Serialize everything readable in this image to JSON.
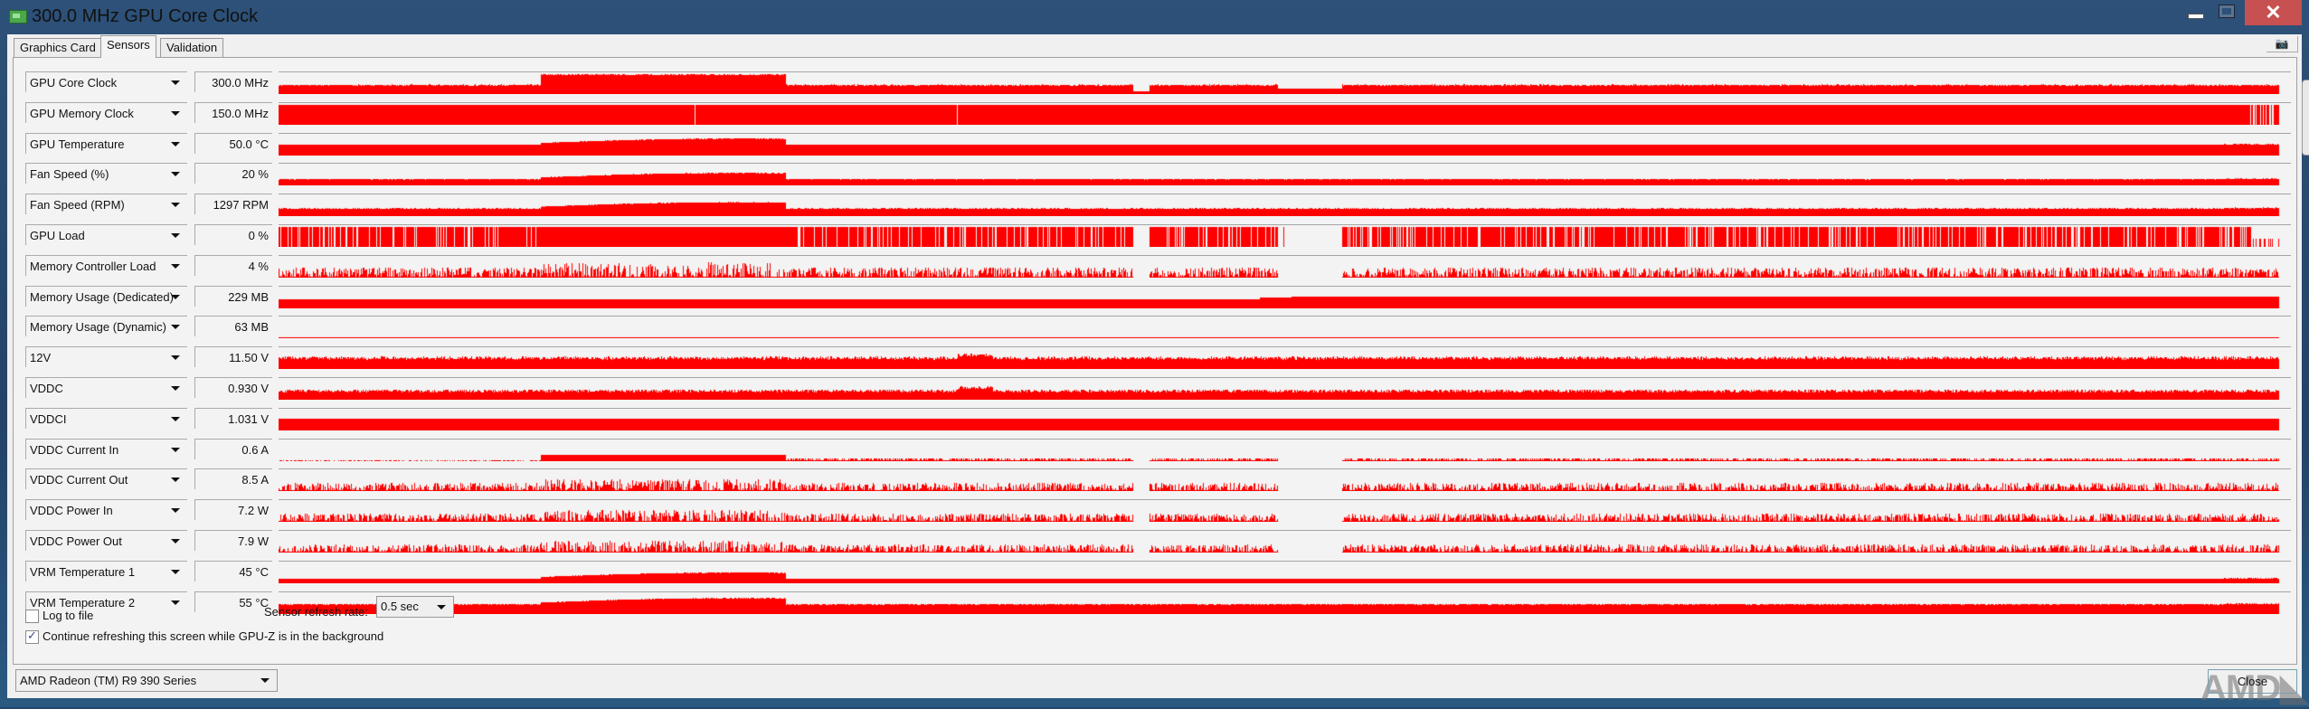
{
  "window": {
    "title": "300.0 MHz GPU Core Clock",
    "minimize": "—",
    "maximize": "□",
    "close": "✕",
    "icon": "gpu-card-icon"
  },
  "tabs": [
    {
      "label": "Graphics Card",
      "active": false
    },
    {
      "label": "Sensors",
      "active": true
    },
    {
      "label": "Validation",
      "active": false
    }
  ],
  "camera_icon": "camera-icon",
  "graph_color": "#ff0000",
  "sensors": [
    {
      "name": "GPU Core Clock",
      "value": "300.0 MHz",
      "graph": {
        "style": "clock",
        "level": 0.4
      }
    },
    {
      "name": "GPU Memory Clock",
      "value": "150.0 MHz",
      "graph": {
        "style": "full",
        "level": 0.95
      }
    },
    {
      "name": "GPU Temperature",
      "value": "50.0 °C",
      "graph": {
        "style": "smooth",
        "level": 0.5
      }
    },
    {
      "name": "Fan Speed (%)",
      "value": "20 %",
      "graph": {
        "style": "smooth",
        "level": 0.28
      }
    },
    {
      "name": "Fan Speed (RPM)",
      "value": "1297 RPM",
      "graph": {
        "style": "smooth",
        "level": 0.35
      }
    },
    {
      "name": "GPU Load",
      "value": "0 %",
      "graph": {
        "style": "load",
        "level": 1.0
      }
    },
    {
      "name": "Memory Controller Load",
      "value": "4 %",
      "graph": {
        "style": "spiky",
        "level": 0.25
      }
    },
    {
      "name": "Memory Usage (Dedicated)",
      "value": "229 MB",
      "graph": {
        "style": "step",
        "level": 0.5
      }
    },
    {
      "name": "Memory Usage (Dynamic)",
      "value": "63 MB",
      "graph": {
        "style": "line",
        "level": 0.02
      }
    },
    {
      "name": "12V",
      "value": "11.50 V",
      "graph": {
        "style": "noisyflat",
        "level": 0.45
      }
    },
    {
      "name": "VDDC",
      "value": "0.930 V",
      "graph": {
        "style": "noisyflat",
        "level": 0.35
      }
    },
    {
      "name": "VDDCI",
      "value": "1.031 V",
      "graph": {
        "style": "flat",
        "level": 0.55
      }
    },
    {
      "name": "VDDC Current In",
      "value": "0.6 A",
      "graph": {
        "style": "lowspiky",
        "level": 0.05
      }
    },
    {
      "name": "VDDC Current Out",
      "value": "8.5 A",
      "graph": {
        "style": "spiky",
        "level": 0.2
      }
    },
    {
      "name": "VDDC Power In",
      "value": "7.2 W",
      "graph": {
        "style": "spiky",
        "level": 0.2
      }
    },
    {
      "name": "VDDC Power Out",
      "value": "7.9 W",
      "graph": {
        "style": "spiky",
        "level": 0.2
      }
    },
    {
      "name": "VRM Temperature 1",
      "value": "45 °C",
      "graph": {
        "style": "smooth",
        "level": 0.2
      }
    },
    {
      "name": "VRM Temperature 2",
      "value": "55 °C",
      "graph": {
        "style": "smooth",
        "level": 0.45
      }
    }
  ],
  "options": {
    "log_to_file": {
      "label": "Log to file",
      "checked": false
    },
    "refresh_label": "Sensor refresh rate:",
    "refresh_value": "0.5 sec",
    "continue_refresh": {
      "label": "Continue refreshing this screen while GPU-Z is in the background",
      "checked": true
    }
  },
  "device_select": "AMD Radeon (TM) R9 390 Series",
  "close_button": "Close",
  "logo": "AMD"
}
